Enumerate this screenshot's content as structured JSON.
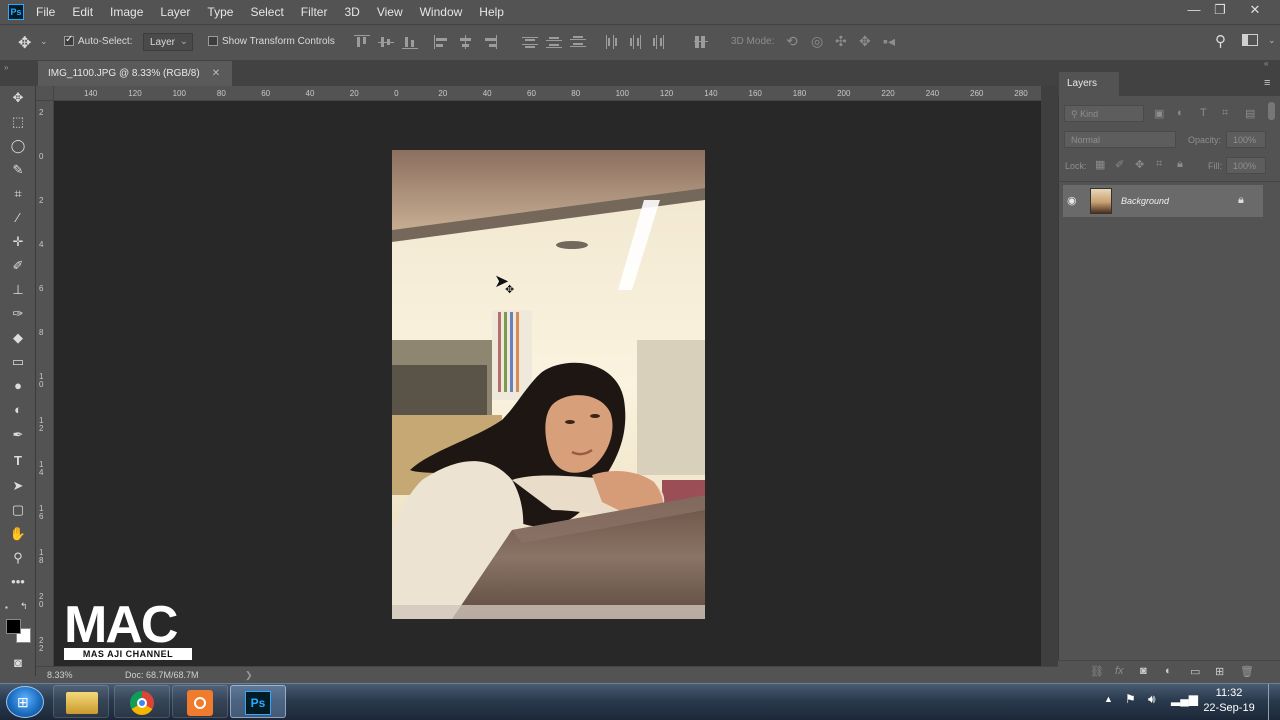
{
  "app": {
    "logo_text": "Ps"
  },
  "menu": [
    "File",
    "Edit",
    "Image",
    "Layer",
    "Type",
    "Select",
    "Filter",
    "3D",
    "View",
    "Window",
    "Help"
  ],
  "window_controls": {
    "minimize": "—",
    "restore": "❐",
    "close": "✕"
  },
  "options_bar": {
    "auto_select_label": "Auto-Select:",
    "auto_select_checked": true,
    "auto_select_target": "Layer",
    "show_transform_label": "Show Transform Controls",
    "show_transform_checked": false,
    "mode_label": "3D Mode:"
  },
  "document_tab": {
    "title": "IMG_1100.JPG @ 8.33% (RGB/8)",
    "close": "✕"
  },
  "ruler_h_labels": [
    "140",
    "120",
    "100",
    "80",
    "60",
    "40",
    "20",
    "0",
    "20",
    "40",
    "60",
    "80",
    "100",
    "120",
    "140",
    "160",
    "180",
    "200",
    "220",
    "240",
    "260",
    "280"
  ],
  "ruler_v_labels": [
    "2",
    "0",
    "2",
    "4",
    "6",
    "8",
    "1 0",
    "1 2",
    "1 4",
    "1 6",
    "1 8",
    "2 0",
    "2 2"
  ],
  "status": {
    "zoom": "8.33%",
    "doc": "Doc: 68.7M/68.7M",
    "arrow": "❯"
  },
  "panel": {
    "tab_label": "Layers",
    "kind_placeholder": "Kind",
    "blend_mode": "Normal",
    "opacity_label": "Opacity:",
    "opacity_value": "100%",
    "lock_label": "Lock:",
    "fill_label": "Fill:",
    "fill_value": "100%",
    "layers": [
      {
        "name": "Background",
        "visible": true,
        "locked": true
      }
    ]
  },
  "watermark": {
    "title": "MAC",
    "subtitle": "MAS AJI CHANNEL"
  },
  "taskbar": {
    "time": "11:32",
    "date": "22-Sep-19"
  },
  "colors": {
    "ui_bg": "#535353",
    "canvas_bg": "#282828",
    "accent": "#31a8ff"
  }
}
